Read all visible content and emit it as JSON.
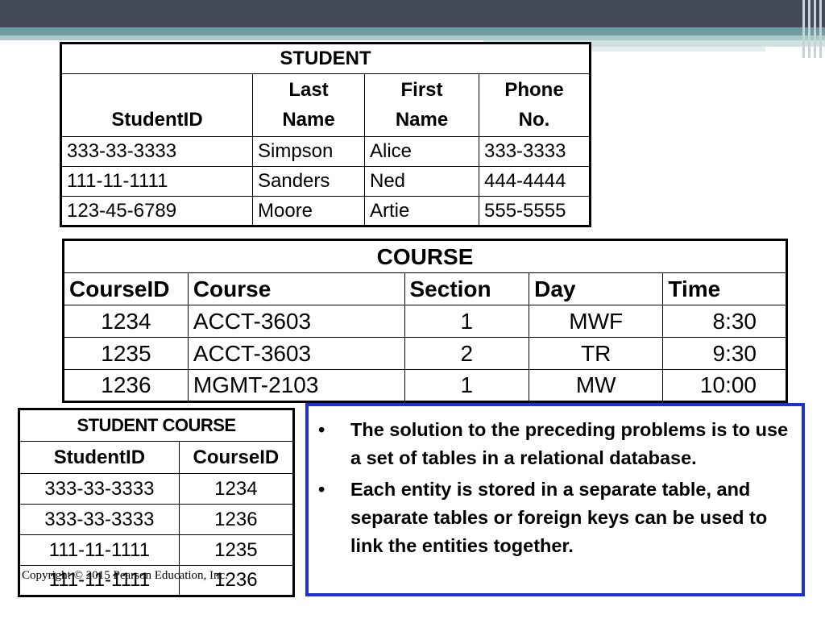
{
  "student_table": {
    "title": "STUDENT",
    "headers": [
      [
        "StudentID"
      ],
      [
        "Last",
        "Name"
      ],
      [
        "First",
        "Name"
      ],
      [
        "Phone",
        "No."
      ]
    ],
    "rows": [
      [
        "333-33-3333",
        "Simpson",
        "Alice",
        "333-3333"
      ],
      [
        "111-11-1111",
        "Sanders",
        "Ned",
        "444-4444"
      ],
      [
        "123-45-6789",
        "Moore",
        "Artie",
        "555-5555"
      ]
    ]
  },
  "course_table": {
    "title": "COURSE",
    "headers": [
      "CourseID",
      "Course",
      "Section",
      "Day",
      "Time"
    ],
    "rows": [
      [
        "1234",
        "ACCT-3603",
        "1",
        "MWF",
        "8:30"
      ],
      [
        "1235",
        "ACCT-3603",
        "2",
        "TR",
        "9:30"
      ],
      [
        "1236",
        "MGMT-2103",
        "1",
        "MW",
        "10:00"
      ]
    ]
  },
  "student_course_table": {
    "title": "STUDENT COURSE",
    "headers": [
      "StudentID",
      "CourseID"
    ],
    "rows": [
      [
        "333-33-3333",
        "1234"
      ],
      [
        "333-33-3333",
        "1236"
      ],
      [
        "111-11-1111",
        "1235"
      ],
      [
        "111-11-1111",
        "1236"
      ]
    ]
  },
  "copyright": "Copyright © 2015 Pearson Education, Inc.",
  "bullets": [
    "The solution to the preceding problems is to use a set of tables in a relational database.",
    "Each entity is stored in a separate table, and separate tables or foreign keys can be used to link the entities together."
  ],
  "bullet_symbol": "•",
  "colors": {
    "banner": "#434959",
    "box_border": "#1f2fd8"
  }
}
